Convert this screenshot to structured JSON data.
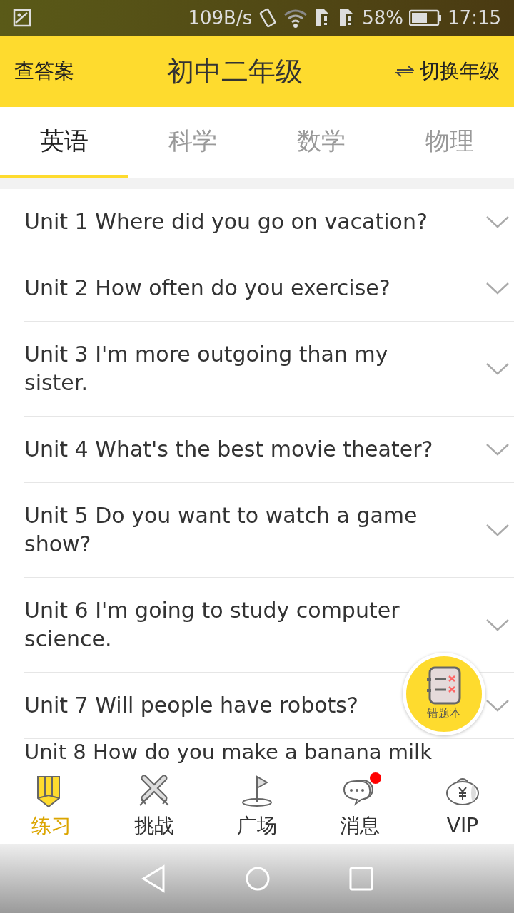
{
  "status_bar": {
    "speed": "109B/s",
    "battery": "58%",
    "time": "17:15"
  },
  "header": {
    "left": "查答案",
    "title": "初中二年级",
    "right": "切换年级"
  },
  "tabs": [
    {
      "label": "英语",
      "selected": true
    },
    {
      "label": "科学",
      "selected": false
    },
    {
      "label": "数学",
      "selected": false
    },
    {
      "label": "物理",
      "selected": false
    }
  ],
  "units": [
    {
      "title": "Unit 1 Where did you go on vacation?"
    },
    {
      "title": "Unit 2 How often do you exercise?"
    },
    {
      "title": "Unit 3 I'm more outgoing than my sister."
    },
    {
      "title": "Unit 4 What's the best movie theater?"
    },
    {
      "title": "Unit 5 Do you want to watch a game show?"
    },
    {
      "title": "Unit 6 I'm going to study computer science."
    },
    {
      "title": "Unit 7 Will people have robots?"
    },
    {
      "title": "Unit 8 How do you make a banana milk"
    }
  ],
  "fab": {
    "label": "错题本"
  },
  "bottom_nav": [
    {
      "label": "练习",
      "selected": true,
      "badge": false
    },
    {
      "label": "挑战",
      "selected": false,
      "badge": false
    },
    {
      "label": "广场",
      "selected": false,
      "badge": false
    },
    {
      "label": "消息",
      "selected": false,
      "badge": true
    },
    {
      "label": "VIP",
      "selected": false,
      "badge": false
    }
  ]
}
